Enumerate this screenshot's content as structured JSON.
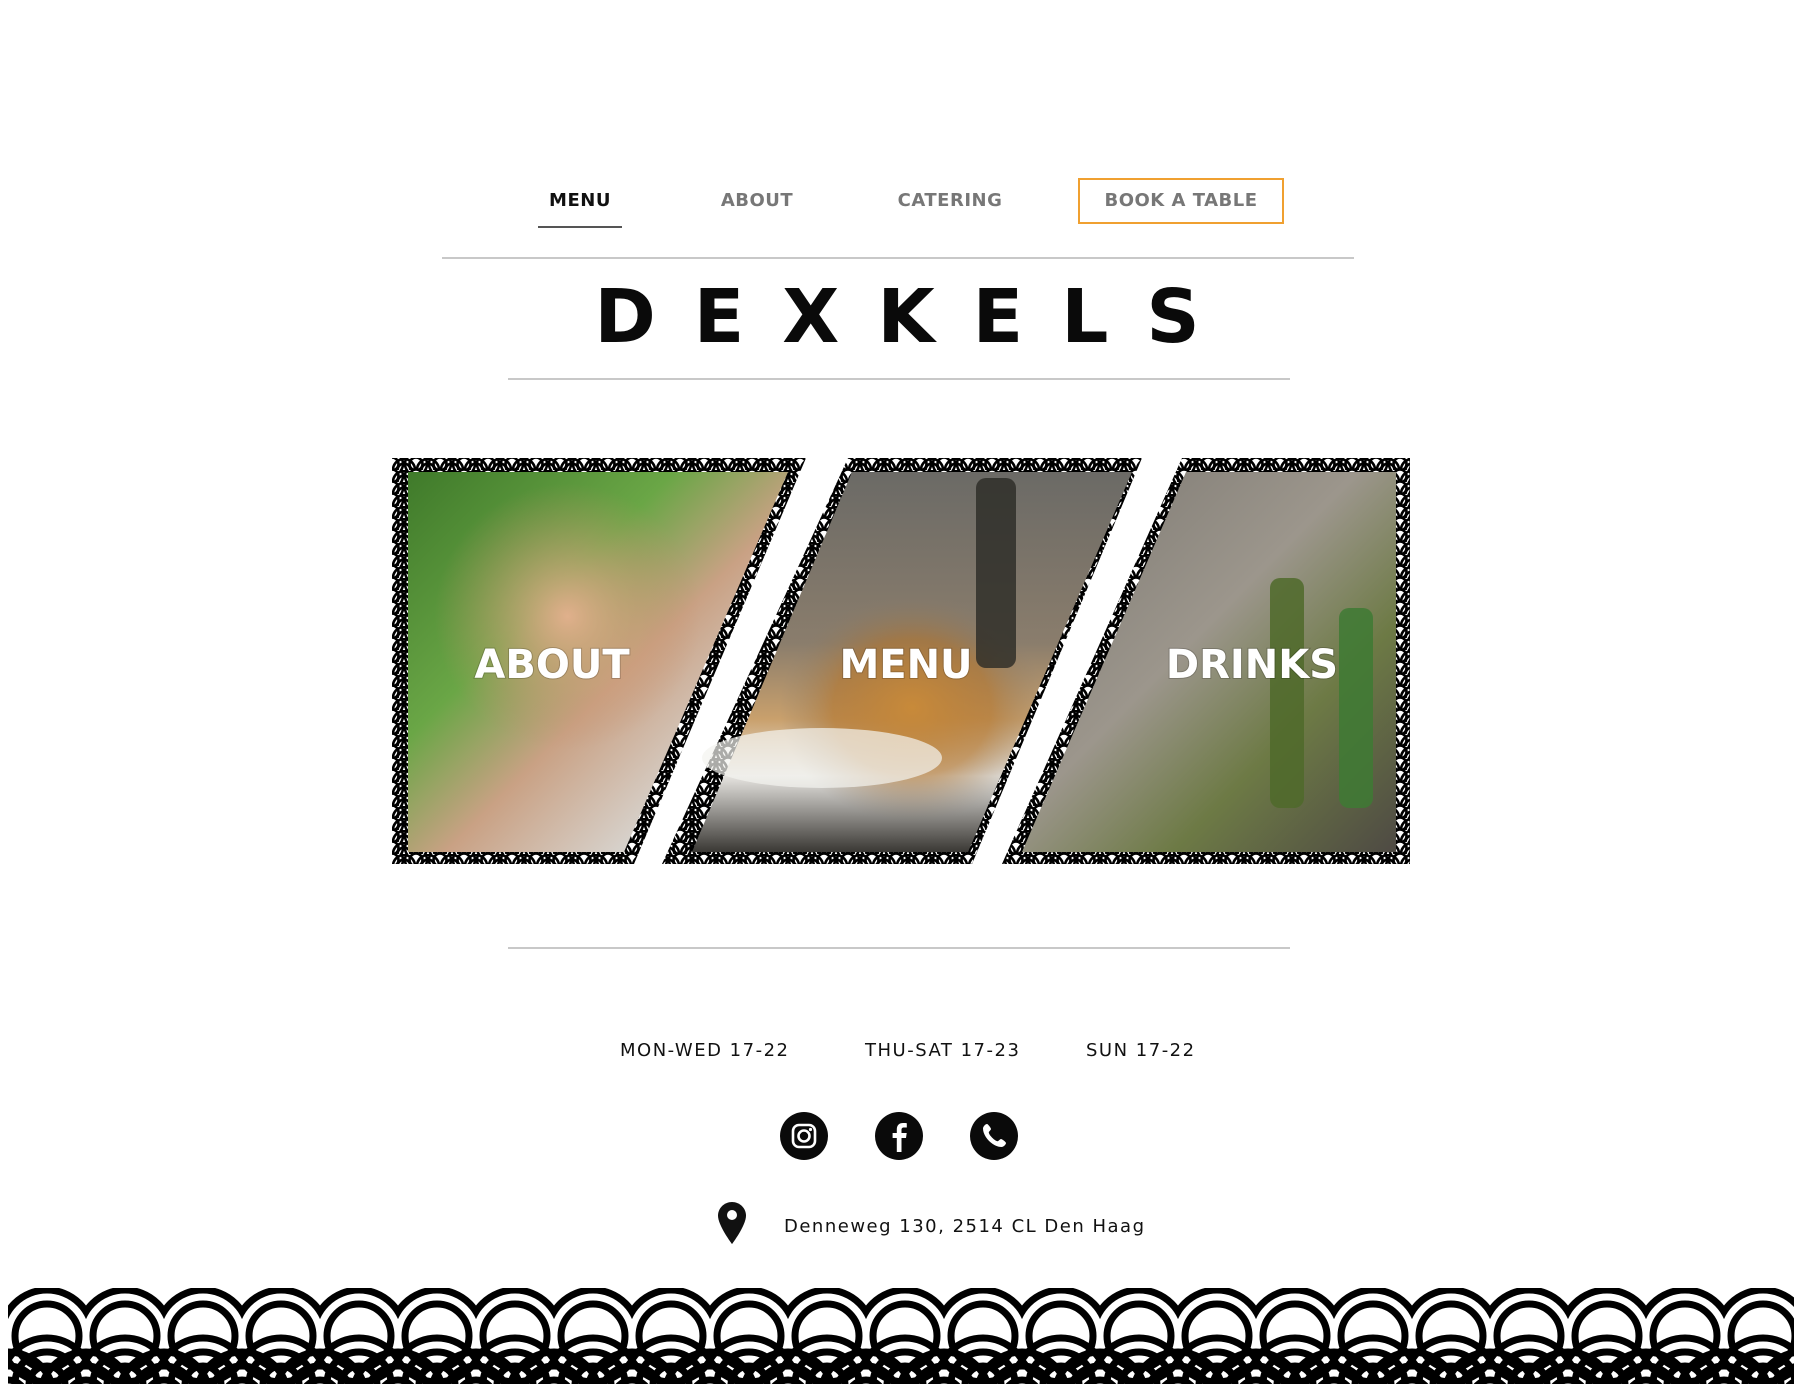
{
  "nav": {
    "items": [
      {
        "label": "MENU",
        "active": true
      },
      {
        "label": "ABOUT",
        "active": false
      },
      {
        "label": "CATERING",
        "active": false
      }
    ],
    "book_label": "BOOK A TABLE",
    "book_border_color": "#f0a030"
  },
  "logo": {
    "text": "DEXKELS"
  },
  "hero": {
    "tiles": [
      {
        "label": "ABOUT",
        "image": "man-eating-food-photo"
      },
      {
        "label": "MENU",
        "image": "fish-dish-and-white-wine-photo"
      },
      {
        "label": "DRINKS",
        "image": "bottles-and-cocktails-photo"
      }
    ],
    "pattern": "seigaiha-wave-pattern"
  },
  "hours": [
    {
      "label": "MON-WED 17-22"
    },
    {
      "label": "THU-SAT 17-23"
    },
    {
      "label": "SUN 17-22"
    }
  ],
  "social": [
    {
      "name": "instagram-icon"
    },
    {
      "name": "facebook-icon"
    },
    {
      "name": "phone-icon"
    }
  ],
  "address": {
    "icon": "location-pin-icon",
    "text": "Denneweg 130, 2514 CL Den Haag"
  },
  "footer": {
    "pattern": "seigaiha-wave-pattern"
  }
}
